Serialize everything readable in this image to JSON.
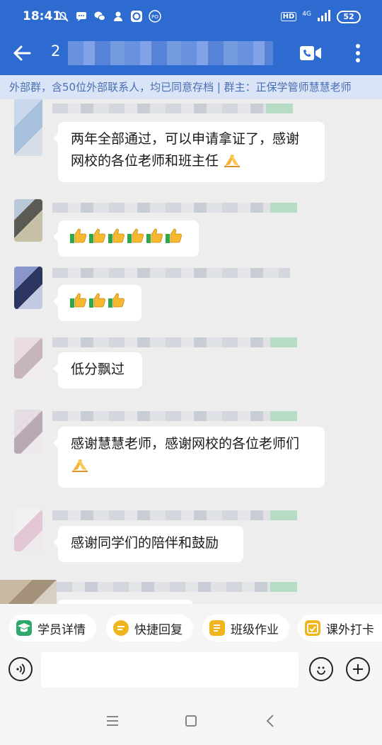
{
  "status_bar": {
    "time": "18:41",
    "network_type": "4G",
    "hd_label": "HD",
    "battery": "52"
  },
  "header": {
    "title": "2",
    "back_icon": "arrow-left-icon",
    "video_call_icon": "video-camera-icon",
    "more_icon": "more-vertical-icon"
  },
  "notice": {
    "text": "外部群，含50位外部联系人，均已同意存档 | 群主：正保学管师慧慧老师"
  },
  "messages": [
    {
      "text": "两年全部通过，可以申请拿证了，感谢网校的各位老师和班主任",
      "emoji": "pray-icon"
    },
    {
      "emoji": "thumbs-up-icon",
      "count": 6
    },
    {
      "emoji": "thumbs-up-icon",
      "count": 3
    },
    {
      "text": "低分飘过"
    },
    {
      "text": "感谢慧慧老师，感谢网校的各位老师们",
      "emoji": "pray-icon"
    },
    {
      "text": "感谢同学们的陪伴和鼓励"
    }
  ],
  "quick_actions": [
    {
      "label": "学员详情",
      "icon": "student-icon",
      "color": "#2ea86b"
    },
    {
      "label": "快捷回复",
      "icon": "quick-reply-icon",
      "color": "#f0b41c"
    },
    {
      "label": "班级作业",
      "icon": "homework-icon",
      "color": "#f0b41c"
    },
    {
      "label": "课外打卡",
      "icon": "checkin-icon",
      "color": "#f0b41c"
    }
  ],
  "input_bar": {
    "placeholder": "",
    "voice_icon": "voice-icon",
    "emoji_icon": "emoji-icon",
    "add_icon": "add-icon"
  },
  "colors": {
    "header_bg": "#2e6bd0",
    "notice_bg": "#d9e4f7",
    "chat_bg": "#ededed"
  }
}
